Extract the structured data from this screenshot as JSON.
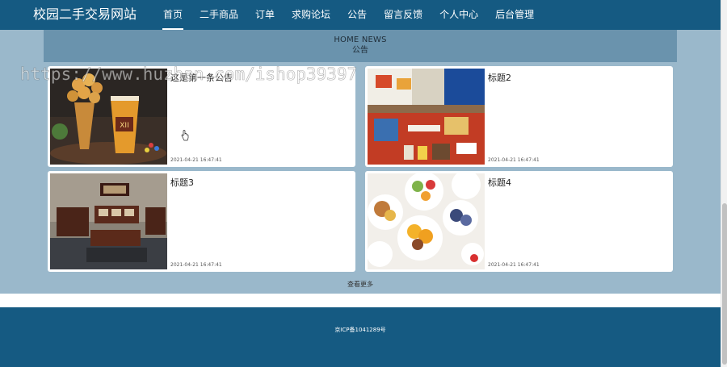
{
  "header": {
    "site_title": "校园二手交易网站",
    "nav": [
      {
        "label": "首页",
        "active": true
      },
      {
        "label": "二手商品"
      },
      {
        "label": "订单"
      },
      {
        "label": "求购论坛"
      },
      {
        "label": "公告"
      },
      {
        "label": "留言反馈"
      },
      {
        "label": "个人中心"
      },
      {
        "label": "后台管理"
      }
    ]
  },
  "news": {
    "heading_en": "HOME NEWS",
    "heading_cn": "公告",
    "items": [
      {
        "title": "这是第一条公告",
        "date": "2021-04-21 16:47:41",
        "image": "waffle-and-milk-tea-photo"
      },
      {
        "title": "标题2",
        "date": "2021-04-21 16:47:41",
        "image": "shop-interior-photo"
      },
      {
        "title": "标题3",
        "date": "2021-04-21 16:47:41",
        "image": "living-room-furniture-photo"
      },
      {
        "title": "标题4",
        "date": "2021-04-21 16:47:41",
        "image": "fruit-yogurt-bowls-photo"
      }
    ],
    "more_label": "查看更多"
  },
  "watermark": "https://www.huzhan.com/ishop39397",
  "footer": {
    "icp": "京ICP备1041289号"
  },
  "colors": {
    "primary": "#155a82",
    "main_bg": "#9ab8cb",
    "section_header_bg": "#6a93ad"
  }
}
